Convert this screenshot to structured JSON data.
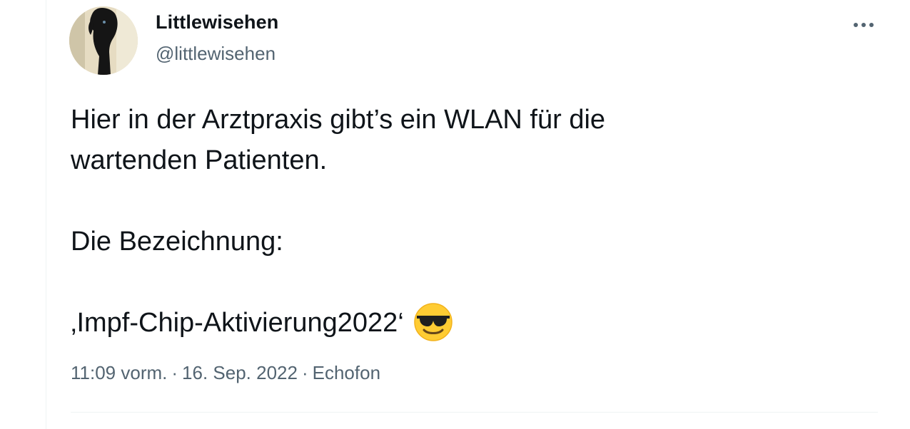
{
  "tweet": {
    "author": {
      "display_name": "Littlewisehen",
      "handle": "@littlewisehen",
      "avatar_icon": "dog-avatar"
    },
    "more_icon": "more-options-icon",
    "text_lines": [
      "Hier in der Arztpraxis gibt’s ein WLAN für die",
      "wartenden Patienten.",
      "",
      "Die Bezeichnung:",
      "",
      "‚Impf-Chip-Aktivierung2022‘"
    ],
    "emoji": "smiling-face-with-sunglasses-emoji",
    "meta": {
      "time": "11:09 vorm.",
      "separator": "·",
      "date": "16. Sep. 2022",
      "source": "Echofon"
    }
  },
  "colors": {
    "text_primary": "#0f1419",
    "text_secondary": "#536471",
    "divider": "#eff3f4"
  }
}
